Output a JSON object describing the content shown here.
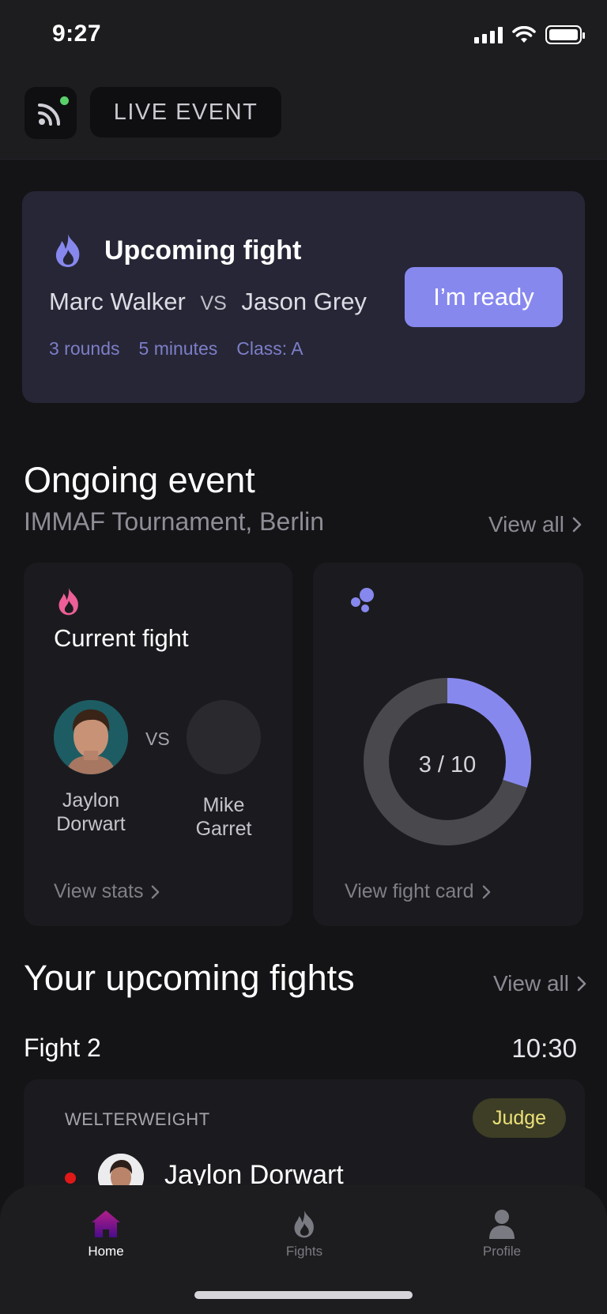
{
  "status_bar": {
    "time": "9:27"
  },
  "header": {
    "live_label": "LIVE EVENT"
  },
  "upcoming_fight": {
    "title": "Upcoming fight",
    "fighter_a": "Marc Walker",
    "vs": "VS",
    "fighter_b": "Jason Grey",
    "rounds": "3 rounds",
    "duration": "5 minutes",
    "class": "Class: A",
    "ready_label": "I’m ready"
  },
  "ongoing_event": {
    "title": "Ongoing event",
    "subtitle": "IMMAF Tournament, Berlin",
    "view_all": "View all",
    "current_fight": {
      "title": "Current fight",
      "vs": "VS",
      "fighter_a_line1": "Jaylon",
      "fighter_a_line2": "Dorwart",
      "fighter_b_line1": "Mike",
      "fighter_b_line2": "Garret",
      "view_stats": "View stats"
    },
    "progress": {
      "label": "3 / 10",
      "completed": 3,
      "total": 10,
      "view_fight_card": "View fight card"
    }
  },
  "your_upcoming": {
    "title": "Your upcoming fights",
    "view_all": "View all",
    "fight_number": "Fight 2",
    "fight_time": "10:30",
    "weight_class": "WELTERWEIGHT",
    "role": "Judge",
    "fighter": "Jaylon Dorwart"
  },
  "tabs": [
    {
      "label": "Home",
      "icon": "home-icon",
      "active": true
    },
    {
      "label": "Fights",
      "icon": "fights-flame-icon",
      "active": false
    },
    {
      "label": "Profile",
      "icon": "profile-icon",
      "active": false
    }
  ],
  "colors": {
    "accent": "#8788ee",
    "live_dot": "#5ad06b",
    "flame_pink": "#ee5f97",
    "judge_text": "#ece07a",
    "red_corner": "#e01818"
  }
}
